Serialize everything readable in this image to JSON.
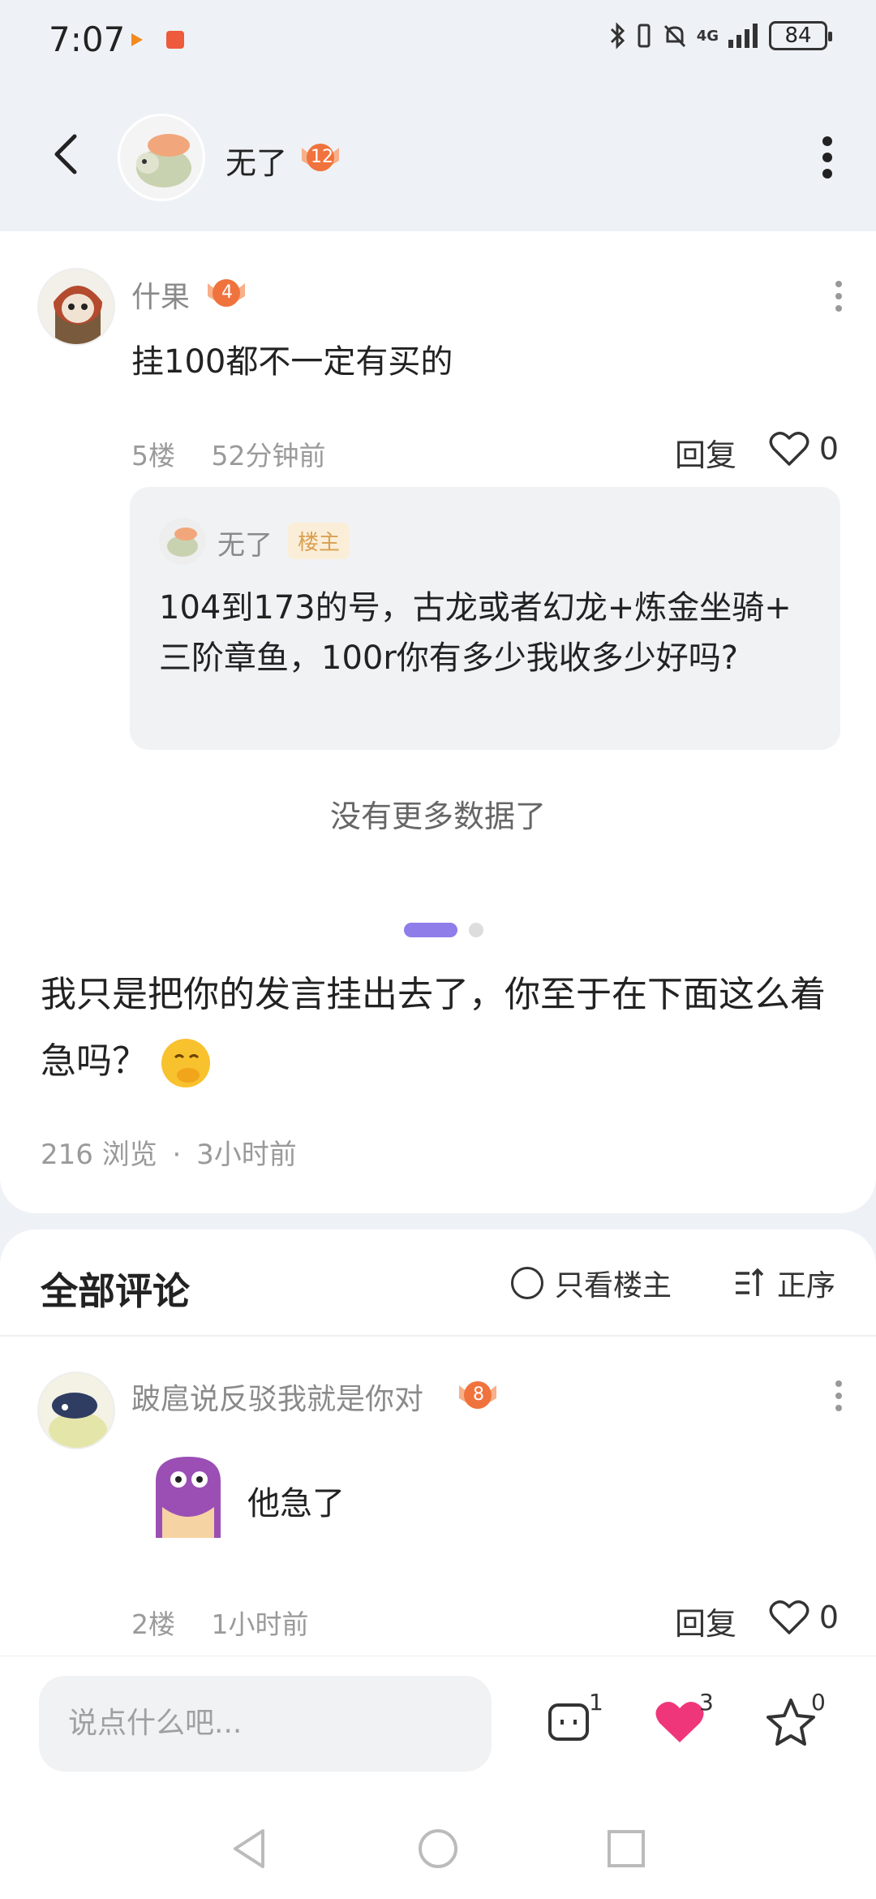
{
  "status_bar": {
    "time": "7:07",
    "battery": "84",
    "network": "4G"
  },
  "header": {
    "author_name": "无了",
    "author_level": "12"
  },
  "quoted_comment": {
    "user_name": "什果",
    "user_level": "4",
    "text": "挂100都不一定有买的",
    "floor": "5楼",
    "time": "52分钟前",
    "reply_label": "回复",
    "like_count": "0",
    "reply": {
      "user_name": "无了",
      "op_tag": "楼主",
      "text": "104到173的号，古龙或者幻龙+炼金坐骑+ 三阶章鱼，100r你有多少我收多少好吗?"
    }
  },
  "no_more_text": "没有更多数据了",
  "post": {
    "text": "我只是把你的发言挂出去了，你至于在下面这么着急吗？",
    "views": "216 浏览",
    "separator": "·",
    "time": "3小时前"
  },
  "comments_section": {
    "title": "全部评论",
    "op_only_label": "只看楼主",
    "sort_label": "正序"
  },
  "comment": {
    "user_name": "跛扈说反驳我就是你对",
    "user_level": "8",
    "text": "他急了",
    "floor": "2楼",
    "time": "1小时前",
    "reply_label": "回复",
    "like_count": "0"
  },
  "bottom_bar": {
    "input_placeholder": "说点什么吧...",
    "comment_count": "1",
    "like_count": "3",
    "favorite_count": "0"
  },
  "colors": {
    "accent_purple": "#8f7dea",
    "like_pink": "#f0367a",
    "op_tag_bg": "#fbeed8",
    "op_tag_text": "#d8a052"
  }
}
